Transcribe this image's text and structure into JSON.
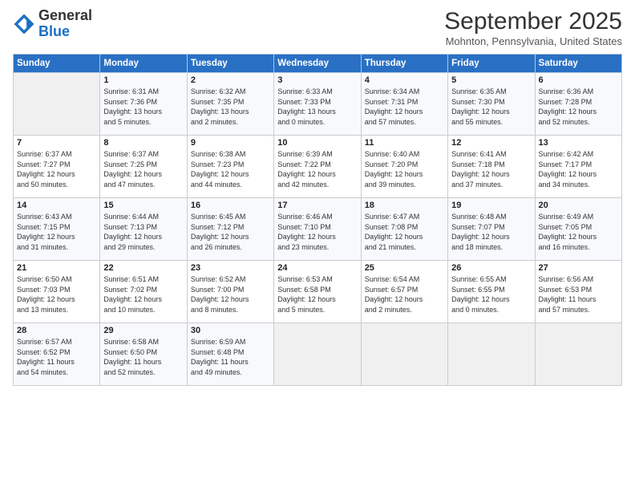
{
  "logo": {
    "general": "General",
    "blue": "Blue"
  },
  "title": "September 2025",
  "subtitle": "Mohnton, Pennsylvania, United States",
  "days_header": [
    "Sunday",
    "Monday",
    "Tuesday",
    "Wednesday",
    "Thursday",
    "Friday",
    "Saturday"
  ],
  "weeks": [
    [
      {
        "day": "",
        "info": ""
      },
      {
        "day": "1",
        "info": "Sunrise: 6:31 AM\nSunset: 7:36 PM\nDaylight: 13 hours\nand 5 minutes."
      },
      {
        "day": "2",
        "info": "Sunrise: 6:32 AM\nSunset: 7:35 PM\nDaylight: 13 hours\nand 2 minutes."
      },
      {
        "day": "3",
        "info": "Sunrise: 6:33 AM\nSunset: 7:33 PM\nDaylight: 13 hours\nand 0 minutes."
      },
      {
        "day": "4",
        "info": "Sunrise: 6:34 AM\nSunset: 7:31 PM\nDaylight: 12 hours\nand 57 minutes."
      },
      {
        "day": "5",
        "info": "Sunrise: 6:35 AM\nSunset: 7:30 PM\nDaylight: 12 hours\nand 55 minutes."
      },
      {
        "day": "6",
        "info": "Sunrise: 6:36 AM\nSunset: 7:28 PM\nDaylight: 12 hours\nand 52 minutes."
      }
    ],
    [
      {
        "day": "7",
        "info": "Sunrise: 6:37 AM\nSunset: 7:27 PM\nDaylight: 12 hours\nand 50 minutes."
      },
      {
        "day": "8",
        "info": "Sunrise: 6:37 AM\nSunset: 7:25 PM\nDaylight: 12 hours\nand 47 minutes."
      },
      {
        "day": "9",
        "info": "Sunrise: 6:38 AM\nSunset: 7:23 PM\nDaylight: 12 hours\nand 44 minutes."
      },
      {
        "day": "10",
        "info": "Sunrise: 6:39 AM\nSunset: 7:22 PM\nDaylight: 12 hours\nand 42 minutes."
      },
      {
        "day": "11",
        "info": "Sunrise: 6:40 AM\nSunset: 7:20 PM\nDaylight: 12 hours\nand 39 minutes."
      },
      {
        "day": "12",
        "info": "Sunrise: 6:41 AM\nSunset: 7:18 PM\nDaylight: 12 hours\nand 37 minutes."
      },
      {
        "day": "13",
        "info": "Sunrise: 6:42 AM\nSunset: 7:17 PM\nDaylight: 12 hours\nand 34 minutes."
      }
    ],
    [
      {
        "day": "14",
        "info": "Sunrise: 6:43 AM\nSunset: 7:15 PM\nDaylight: 12 hours\nand 31 minutes."
      },
      {
        "day": "15",
        "info": "Sunrise: 6:44 AM\nSunset: 7:13 PM\nDaylight: 12 hours\nand 29 minutes."
      },
      {
        "day": "16",
        "info": "Sunrise: 6:45 AM\nSunset: 7:12 PM\nDaylight: 12 hours\nand 26 minutes."
      },
      {
        "day": "17",
        "info": "Sunrise: 6:46 AM\nSunset: 7:10 PM\nDaylight: 12 hours\nand 23 minutes."
      },
      {
        "day": "18",
        "info": "Sunrise: 6:47 AM\nSunset: 7:08 PM\nDaylight: 12 hours\nand 21 minutes."
      },
      {
        "day": "19",
        "info": "Sunrise: 6:48 AM\nSunset: 7:07 PM\nDaylight: 12 hours\nand 18 minutes."
      },
      {
        "day": "20",
        "info": "Sunrise: 6:49 AM\nSunset: 7:05 PM\nDaylight: 12 hours\nand 16 minutes."
      }
    ],
    [
      {
        "day": "21",
        "info": "Sunrise: 6:50 AM\nSunset: 7:03 PM\nDaylight: 12 hours\nand 13 minutes."
      },
      {
        "day": "22",
        "info": "Sunrise: 6:51 AM\nSunset: 7:02 PM\nDaylight: 12 hours\nand 10 minutes."
      },
      {
        "day": "23",
        "info": "Sunrise: 6:52 AM\nSunset: 7:00 PM\nDaylight: 12 hours\nand 8 minutes."
      },
      {
        "day": "24",
        "info": "Sunrise: 6:53 AM\nSunset: 6:58 PM\nDaylight: 12 hours\nand 5 minutes."
      },
      {
        "day": "25",
        "info": "Sunrise: 6:54 AM\nSunset: 6:57 PM\nDaylight: 12 hours\nand 2 minutes."
      },
      {
        "day": "26",
        "info": "Sunrise: 6:55 AM\nSunset: 6:55 PM\nDaylight: 12 hours\nand 0 minutes."
      },
      {
        "day": "27",
        "info": "Sunrise: 6:56 AM\nSunset: 6:53 PM\nDaylight: 11 hours\nand 57 minutes."
      }
    ],
    [
      {
        "day": "28",
        "info": "Sunrise: 6:57 AM\nSunset: 6:52 PM\nDaylight: 11 hours\nand 54 minutes."
      },
      {
        "day": "29",
        "info": "Sunrise: 6:58 AM\nSunset: 6:50 PM\nDaylight: 11 hours\nand 52 minutes."
      },
      {
        "day": "30",
        "info": "Sunrise: 6:59 AM\nSunset: 6:48 PM\nDaylight: 11 hours\nand 49 minutes."
      },
      {
        "day": "",
        "info": ""
      },
      {
        "day": "",
        "info": ""
      },
      {
        "day": "",
        "info": ""
      },
      {
        "day": "",
        "info": ""
      }
    ]
  ]
}
